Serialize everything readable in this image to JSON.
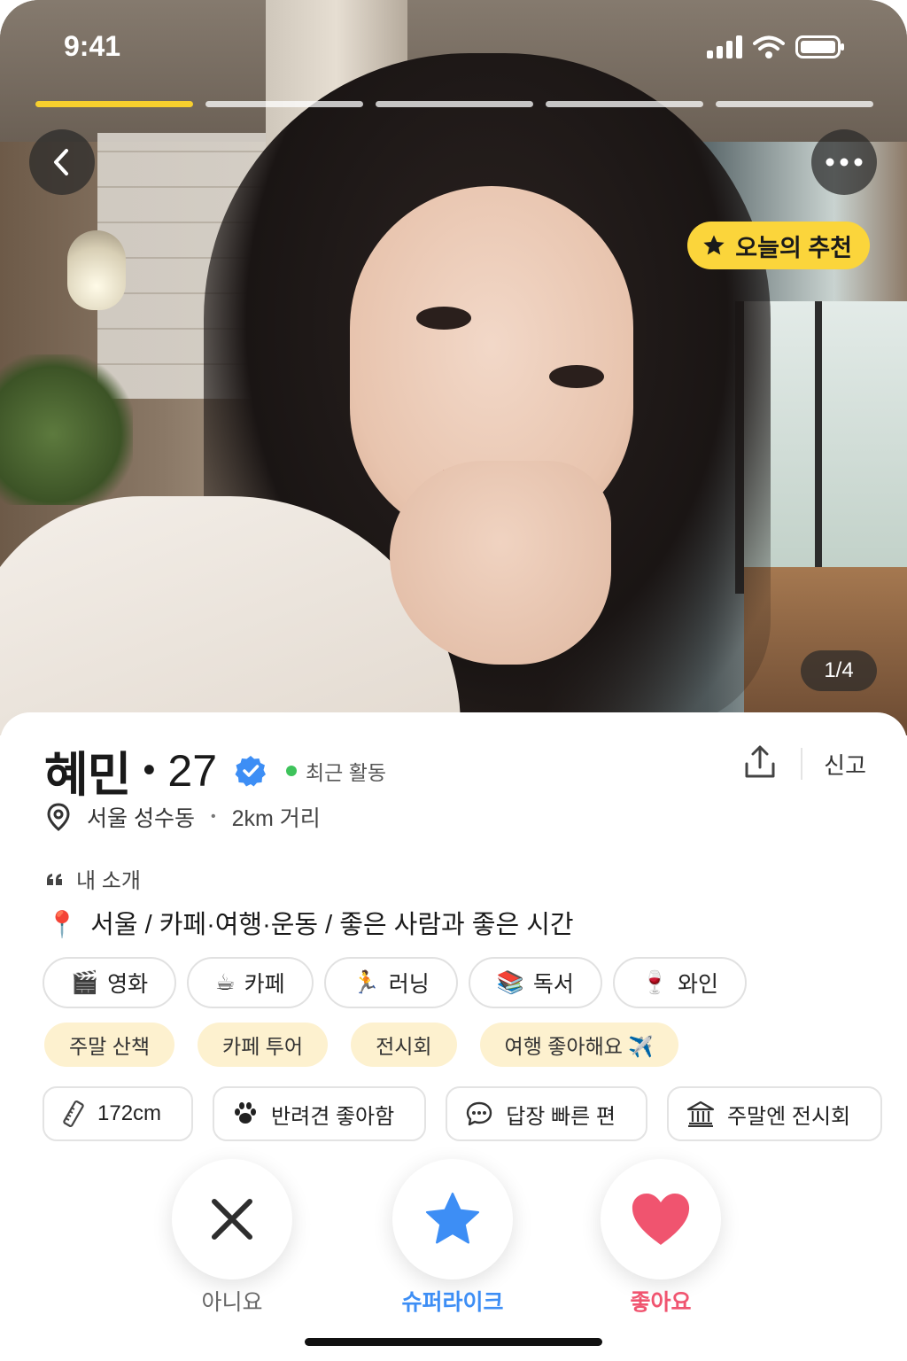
{
  "status_bar": {
    "time": "9:41"
  },
  "photo": {
    "progress_segments": 5,
    "active_segment": 1,
    "badge_label": "오늘의 추천",
    "counter": "1/4"
  },
  "profile": {
    "name": "혜민",
    "separator": "•",
    "age": "27",
    "activity": "최근 활동",
    "report_label": "신고",
    "location": "서울 성수동",
    "distance": "2km 거리",
    "intro_label": "내 소개",
    "intro_pin": "📍",
    "intro_text": "서울 / 카페·여행·운동 / 좋은 사람과 좋은 시간"
  },
  "interests": [
    {
      "emoji": "🎬",
      "label": "영화"
    },
    {
      "emoji": "☕",
      "label": "카페"
    },
    {
      "emoji": "🏃",
      "label": "러닝"
    },
    {
      "emoji": "📚",
      "label": "독서"
    },
    {
      "emoji": "🍷",
      "label": "와인"
    }
  ],
  "tags": [
    "주말 산책",
    "카페 투어",
    "전시회",
    "여행 좋아해요 ✈️"
  ],
  "info": [
    {
      "icon": "ruler-icon",
      "label": "172cm"
    },
    {
      "icon": "paw-icon",
      "label": "반려견 좋아함"
    },
    {
      "icon": "chat-icon",
      "label": "답장 빠른 편"
    },
    {
      "icon": "museum-icon",
      "label": "주말엔 전시회"
    }
  ],
  "actions": {
    "nope_label": "아니요",
    "superlike_label": "슈퍼라이크",
    "like_label": "좋아요"
  },
  "colors": {
    "accent_yellow": "#f7cf2e",
    "superlike_blue": "#3d8ef5",
    "like_pink": "#f0546f",
    "verified_blue": "#3d8ef5",
    "online_green": "#3ec35b",
    "tag_bg": "#fdf1cf"
  }
}
